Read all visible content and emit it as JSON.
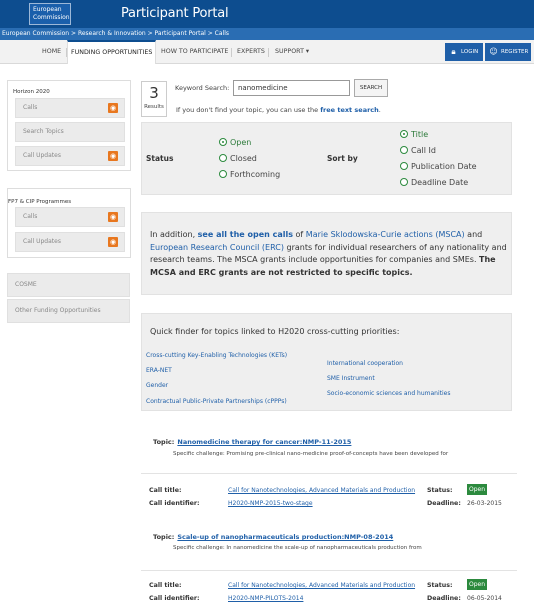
{
  "header": {
    "logo_line1": "European",
    "logo_line2": "Commission",
    "title": "Participant Portal"
  },
  "breadcrumb": "European Commission > Research & Innovation > Participant Portal > Calls",
  "nav": {
    "items": [
      "HOME",
      "FUNDING OPPORTUNITIES",
      "HOW TO PARTICIPATE",
      "EXPERTS",
      "SUPPORT ▾"
    ],
    "login": "LOGIN",
    "register": "REGISTER"
  },
  "sidebar": {
    "h2020_heading": "Horizon 2020",
    "h2020_items": [
      "Calls",
      "Search Topics",
      "Call Updates"
    ],
    "fp7_heading": "FP7 & CIP Programmes",
    "fp7_items": [
      "Calls",
      "Call Updates"
    ],
    "extra_items": [
      "COSME",
      "Other Funding Opportunities"
    ]
  },
  "search": {
    "results_count": "3",
    "results_label": "Results",
    "keyword_label": "Keyword Search:",
    "keyword_value": "nanomedicine",
    "button": "SEARCH",
    "hint_prefix": "If you don't find your topic, you can use the",
    "hint_link": "free text search",
    "hint_suffix": "."
  },
  "filters": {
    "status_label": "Status",
    "status_options": [
      "Open",
      "Closed",
      "Forthcoming"
    ],
    "status_selected": "Open",
    "sort_label": "Sort by",
    "sort_options": [
      "Title",
      "Call Id",
      "Publication Date",
      "Deadline Date"
    ],
    "sort_selected": "Title"
  },
  "info": {
    "t1": "In addition,",
    "l1": "see all the open calls",
    "t2": "of",
    "l2": "Marie Sklodowska-Curie actions (MSCA)",
    "t3": "and",
    "l3": "European Research Council (ERC)",
    "t4": "grants for individual researchers of any nationality and research teams. The MSCA grants include opportunities for companies and SMEs.",
    "t5": "The MCSA and ERC grants are not restricted to specific topics."
  },
  "quickfinder": {
    "title": "Quick finder for topics linked to H2020 cross-cutting priorities:",
    "left": [
      "Cross-cutting Key-Enabling Technologies (KETs)",
      "ERA-NET",
      "Gender",
      "Contractual Public-Private Partnerships (cPPPs)"
    ],
    "right": [
      "International cooperation",
      "SME Instrument",
      "Socio-economic sciences and humanities"
    ]
  },
  "topics": [
    {
      "label": "Topic:",
      "title": "Nanomedicine therapy for cancer:NMP-11-2015",
      "challenge": "Specific challenge: Promising pre-clinical nano-medicine proof-of-concepts have been developed for",
      "call_title_label": "Call title:",
      "call_title": "Call for Nanotechnologies, Advanced Materials and Production",
      "call_id_label": "Call identifier:",
      "call_id": "H2020-NMP-2015-two-stage",
      "status_label": "Status:",
      "status": "Open",
      "deadline_label": "Deadline:",
      "deadline": "26-03-2015"
    },
    {
      "label": "Topic:",
      "title": "Scale-up of nanopharmaceuticals production:NMP-08-2014",
      "challenge": "Specific challenge: In nanomedicine the scale-up of nanopharmaceuticals production from",
      "call_title_label": "Call title:",
      "call_title": "Call for Nanotechnologies, Advanced Materials and Production",
      "call_id_label": "Call identifier:",
      "call_id": "H2020-NMP-PILOTS-2014",
      "status_label": "Status:",
      "status": "Open",
      "deadline_label": "Deadline:",
      "deadline": "06-05-2014"
    }
  ],
  "colors": {
    "header_blue": "#0d4d8f",
    "breadcrumb_blue": "#2a6db3",
    "link_blue": "#1f5fa8",
    "status_green": "#2c8a3e",
    "rss_orange": "#e8771f"
  }
}
